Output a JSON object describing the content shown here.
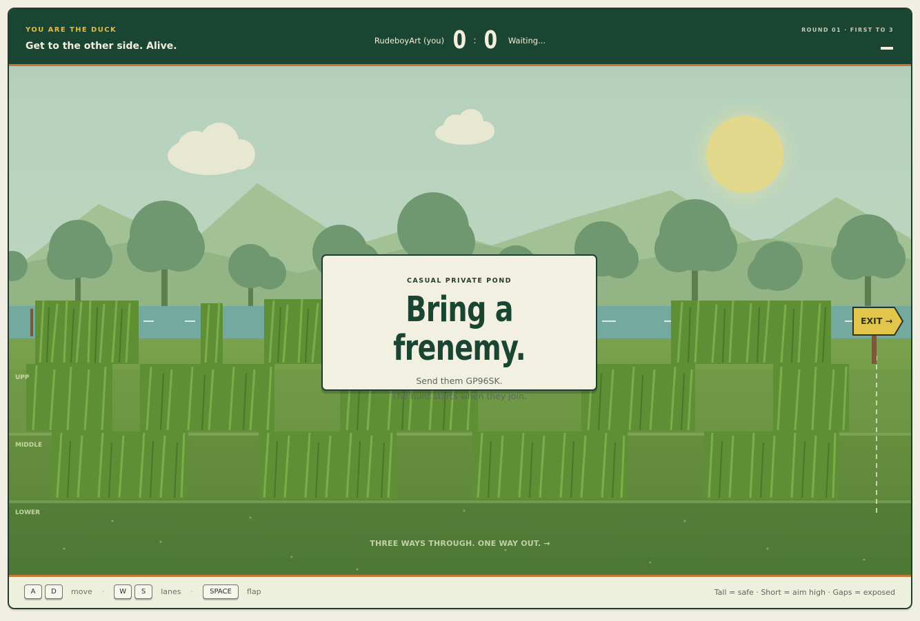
{
  "hud": {
    "role": "YOU ARE THE DUCK",
    "goal": "Get to the other side. Alive.",
    "player_name": "RudeboyArt (you)",
    "player_score": "0",
    "separator": ":",
    "opponent_score": "0",
    "opponent_status": "Waiting...",
    "round": "ROUND 01 · FIRST TO 3"
  },
  "scene": {
    "lanes": [
      "UPP",
      "MIDDLE",
      "LOWER"
    ],
    "tagline": "THREE WAYS THROUGH. ONE WAY OUT. →",
    "exit_sign": "EXIT →"
  },
  "modal": {
    "kicker": "CASUAL PRIVATE POND",
    "title": "Bring a frenemy.",
    "line1": "Send them GP96SK.",
    "line2": "The hunt starts when they join."
  },
  "footer": {
    "keys_move": [
      "A",
      "D"
    ],
    "move_label": "move",
    "keys_lanes": [
      "W",
      "S"
    ],
    "lanes_label": "lanes",
    "key_flap": "SPACE",
    "flap_label": "flap",
    "separator": "·",
    "legend": "Tall = safe · Short = aim high · Gaps = exposed"
  },
  "colors": {
    "hud_bg": "#1a4532",
    "accent_orange": "#c87a35",
    "role_yellow": "#e8b93a",
    "sky": "#b7d2bd",
    "sun": "#e3d98d",
    "grass": "#6f9a48"
  }
}
